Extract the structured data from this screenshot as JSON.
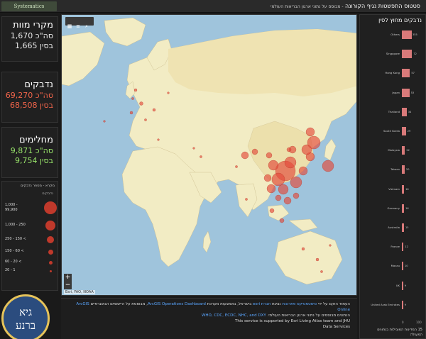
{
  "header": {
    "logo": "Systematics",
    "title": "סטטוס התפשטות נגיף הקורונה",
    "subtitle": "- מבוסס על נתוני ארגון הבריאות העולמי"
  },
  "stats": {
    "deaths": {
      "label": "מקרי מוות",
      "total": "סה\"כ 1,670",
      "china": "בסין 1,665"
    },
    "cases": {
      "label": "נדבקים",
      "total": "סה\"כ 69,270",
      "china": "בסין 68,508"
    },
    "recovered": {
      "label": "מחלימים",
      "total": "סה\"כ 9,871",
      "china": "בסין 9,754"
    }
  },
  "legend": {
    "title": "מקרא - מספר נדבקים",
    "subtitle": "נדבקים",
    "items": [
      {
        "label": "1,000 -",
        "label2": "99,900",
        "size": 18
      },
      {
        "label": "1,000 - 250",
        "size": 14
      },
      {
        "label": "250 - 150 <",
        "size": 10
      },
      {
        "label": "150 - 60 <",
        "size": 7
      },
      {
        "label": "60 - 20 <",
        "size": 5
      },
      {
        "label": "20 - 1",
        "size": 3
      }
    ]
  },
  "badge": {
    "line1": "גיא",
    "line2": "ברנע"
  },
  "map": {
    "attribution": "Esri, FAO, NOAA",
    "tools": [
      "grid-icon",
      "list-icon",
      "search-icon"
    ]
  },
  "info": {
    "line1a": "העמוד הוקם על ידי ",
    "line1b": "סיסטמטיקס פתרונות",
    "line1c": " נציגת ",
    "line1d": "חברת esri",
    "line1e": " בישראל, באמצעות מערכת ",
    "line1f": "ArcGIS Operations Dashboard",
    "line1g": ", מבוססת על היישומים הגאוגרפיים ",
    "line1h": "ArcGIS",
    "line2": "Online",
    "line3a": "הנתונים מבוססים על נתוני ארגון הבריאות העולמי. ",
    "line3b": "WHO, CDC, ECDC, NHC, and DXY",
    "line3c": "This service is supported by Esri Living Atlas team and JHU",
    "line4": "Data Services"
  },
  "right": {
    "title": "נדבקים מחוץ לסין",
    "footer1": "15 המדינות המובילות בנתונים",
    "footer2": "המעולה"
  },
  "chart_data": {
    "type": "bar",
    "orientation": "horizontal",
    "title": "נדבקים מחוץ לסין",
    "categories": [
      "Others",
      "Singapore",
      "Hong Kong",
      "Japan",
      "Thailand",
      "South Korea",
      "Malaysia",
      "Taiwan",
      "Vietnam",
      "Germany",
      "Australia",
      "France",
      "Macau",
      "UK",
      "United Arab Emirates"
    ],
    "values": [
      355,
      72,
      57,
      53,
      34,
      29,
      22,
      20,
      16,
      16,
      15,
      12,
      10,
      9,
      9
    ],
    "xlim": [
      0,
      100
    ],
    "xticks": [
      0,
      100
    ]
  },
  "colors": {
    "case_dot": "#e34a3a",
    "cases_text": "#f0644a",
    "recovered_text": "#98e36a",
    "bar": "#d97a7a",
    "link": "#5aa6ff"
  }
}
